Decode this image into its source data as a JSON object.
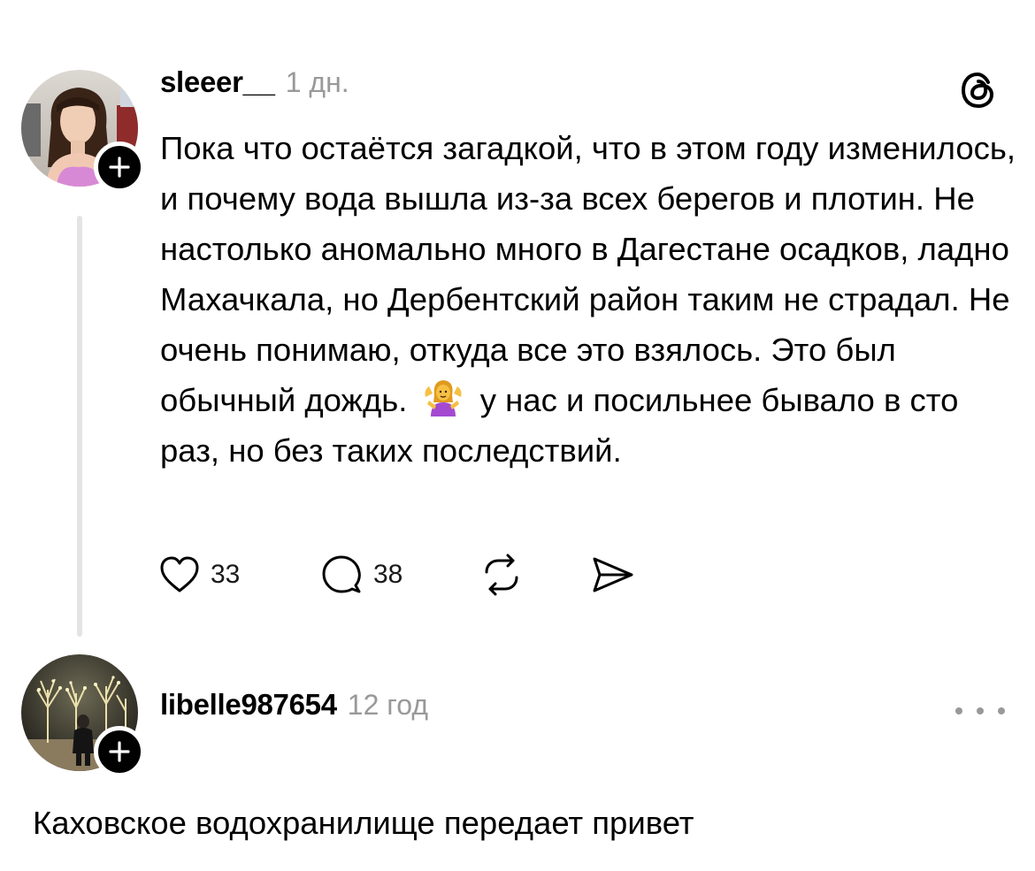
{
  "post1": {
    "username": "sleeer__",
    "timestamp": "1 дн.",
    "body_part1": "Пока что остаётся загадкой, что в этом году изменилось, и почему вода вышла из-за всех берегов и плотин. Не настолько аномально много в Дагестане осадков, ладно Махачкала, но Дербентский район таким не страдал. Не очень понимаю, откуда все это взялось. Это был обычный дождь.",
    "emoji": "person-shrugging-emoji",
    "body_part2": "у нас и посильнее бывало в сто раз, но без таких последствий.",
    "likes": "33",
    "replies": "38",
    "icons": [
      "heart-icon",
      "comment-icon",
      "repost-icon",
      "share-icon",
      "threads-logo-icon",
      "plus-icon"
    ]
  },
  "post2": {
    "username": "libelle987654",
    "timestamp": "12 год",
    "body": "Каховское водохранилище передает привет",
    "icons": [
      "more-icon",
      "plus-icon"
    ]
  },
  "colors": {
    "text": "#000000",
    "muted": "#999999",
    "thread_line": "#e4e4e4",
    "background": "#ffffff"
  }
}
